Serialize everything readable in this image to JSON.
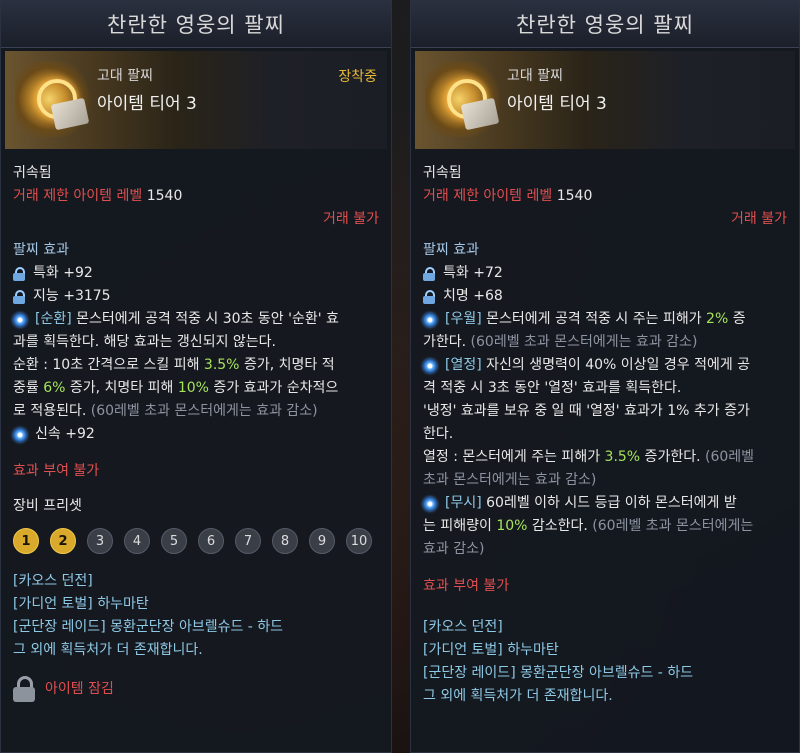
{
  "left": {
    "title": "찬란한 영웅의 팔찌",
    "item_type": "고대 팔찌",
    "item_tier": "아이템 티어 3",
    "equipped": "장착중",
    "bound": "귀속됨",
    "trade_level_label": "거래 제한 아이템 레벨",
    "trade_level_value": "1540",
    "no_trade": "거래 불가",
    "effects_title": "팔찌 효과",
    "stat1": "특화 +92",
    "stat2": "지능 +3175",
    "cycle_line1_tag": "[순환]",
    "cycle_line1_rest": " 몬스터에게 공격 적중 시 30초 동안 '순환' 효",
    "cycle_line2": "과를 획득한다. 해당 효과는 갱신되지 않는다.",
    "cycle_line3_a": "순환 : 10초 간격으로 스킬 피해 ",
    "cycle_line3_b": "3.5%",
    "cycle_line3_c": " 증가, 치명타 적",
    "cycle_line4_a": "중률 ",
    "cycle_line4_b": "6%",
    "cycle_line4_c": " 증가, 치명타 피해 ",
    "cycle_line4_d": "10%",
    "cycle_line4_e": " 증가 효과가 순차적으",
    "cycle_line5_a": "로 적용된다.",
    "cycle_line5_b": " (60레벨 초과 몬스터에게는 효과 감소)",
    "stat3": "신속 +92",
    "no_effect": "효과 부여 불가",
    "preset_title": "장비 프리셋",
    "presets": [
      "1",
      "2",
      "3",
      "4",
      "5",
      "6",
      "7",
      "8",
      "9",
      "10"
    ],
    "source1": "[카오스 던전]",
    "source2": "[가디언 토벌] 하누마탄",
    "source3": "[군단장 레이드] 몽환군단장 아브렐슈드 - 하드",
    "source4": "그 외에 획득처가 더 존재합니다.",
    "lock_label": "아이템 잠김"
  },
  "right": {
    "title": "찬란한 영웅의 팔찌",
    "item_type": "고대 팔찌",
    "item_tier": "아이템 티어 3",
    "bound": "귀속됨",
    "trade_level_label": "거래 제한 아이템 레벨",
    "trade_level_value": "1540",
    "no_trade": "거래 불가",
    "effects_title": "팔찌 효과",
    "stat1": "특화 +72",
    "stat2": "치명 +68",
    "sup_line1_tag": "[우월]",
    "sup_line1_a": " 몬스터에게 공격 적중 시 주는 피해가 ",
    "sup_line1_b": "2%",
    "sup_line1_c": " 증",
    "sup_line2_a": "가한다.",
    "sup_line2_b": " (60레벨 초과 몬스터에게는 효과 감소)",
    "heat_line1_tag": "[열정]",
    "heat_line1_rest": " 자신의 생명력이 40% 이상일 경우 적에게 공",
    "heat_line2": "격 적중 시 3초 동안 '열정' 효과를 획득한다.",
    "heat_line3": "'냉정' 효과를 보유 중 일 때 '열정' 효과가 1% 추가 증가",
    "heat_line4": "한다.",
    "heat_line5_a": "열정 : 몬스터에게 주는 피해가 ",
    "heat_line5_b": "3.5%",
    "heat_line5_c": " 증가한다.",
    "heat_line5_d": " (60레벨",
    "heat_line6": "초과 몬스터에게는 효과 감소)",
    "dis_line1_tag": "[무시]",
    "dis_line1_rest": " 60레벨 이하 시드 등급 이하 몬스터에게 받",
    "dis_line2_a": "는 피해량이 ",
    "dis_line2_b": "10%",
    "dis_line2_c": " 감소한다.",
    "dis_line2_d": " (60레벨 초과 몬스터에게는",
    "dis_line3": "효과 감소)",
    "no_effect": "효과 부여 불가",
    "source1": "[카오스 던전]",
    "source2": "[가디언 토벌] 하누마탄",
    "source3": "[군단장 레이드] 몽환군단장 아브렐슈드 - 하드",
    "source4": "그 외에 획득처가 더 존재합니다."
  },
  "colors": {
    "accent_gold": "#e8b837",
    "warning_red": "#e04f4f",
    "highlight_green": "#a5e35a",
    "section_blue": "#a6c8e6"
  }
}
